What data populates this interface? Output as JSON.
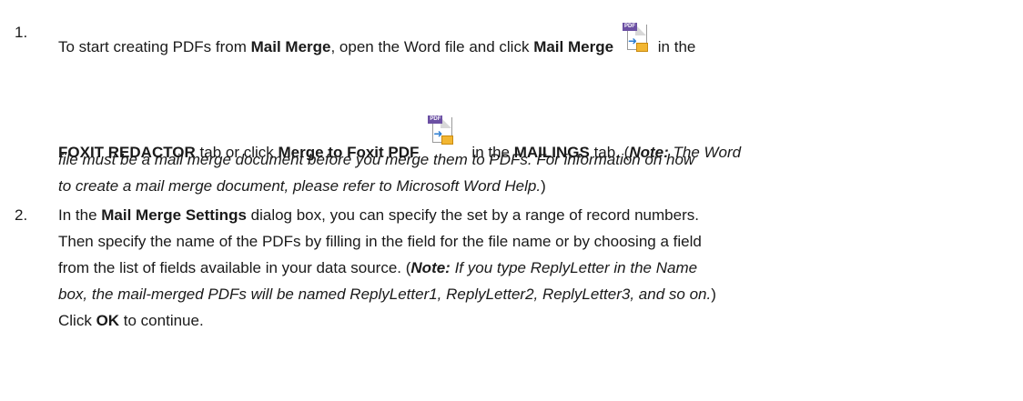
{
  "steps": [
    {
      "number": "1.",
      "seg1": "To start creating PDFs from ",
      "b1": "Mail Merge",
      "seg2": ", open the Word file and click ",
      "b2": "Mail Merge",
      "seg3": " in the",
      "b3": "FOXIT REDACTOR",
      "seg4": " tab or click ",
      "b4": "Merge to Foxit PDF",
      "seg5": "in the ",
      "b5": "MAILINGS",
      "seg6": " tab. (",
      "note_label": "Note:",
      "note_a": " The Word",
      "note_b": "file must be a mail merge document before you merge them to PDFs. For information on how",
      "note_c": "to create a mail merge document, please refer to Microsoft Word Help.",
      "close": ")"
    },
    {
      "number": "2.",
      "a1": "In the ",
      "b1": "Mail Merge Settings",
      "a2": " dialog box, you can specify the set by a range of record numbers.",
      "l2": "Then specify the name of the PDFs by filling in the field for the file name or by choosing a field",
      "l3a": "from the list of fields available in your data source. (",
      "note_label": "Note:",
      "l3b": " If you type ReplyLetter in the Name",
      "l4": "box, the mail-merged PDFs will be named ReplyLetter1, ReplyLetter2, ReplyLetter3, and so on.",
      "l4close": ")",
      "l5a": "Click ",
      "ok": "OK",
      "l5b": " to continue."
    }
  ],
  "icons": {
    "mail_merge": "mail-merge-icon",
    "tag_text": "PDF"
  }
}
